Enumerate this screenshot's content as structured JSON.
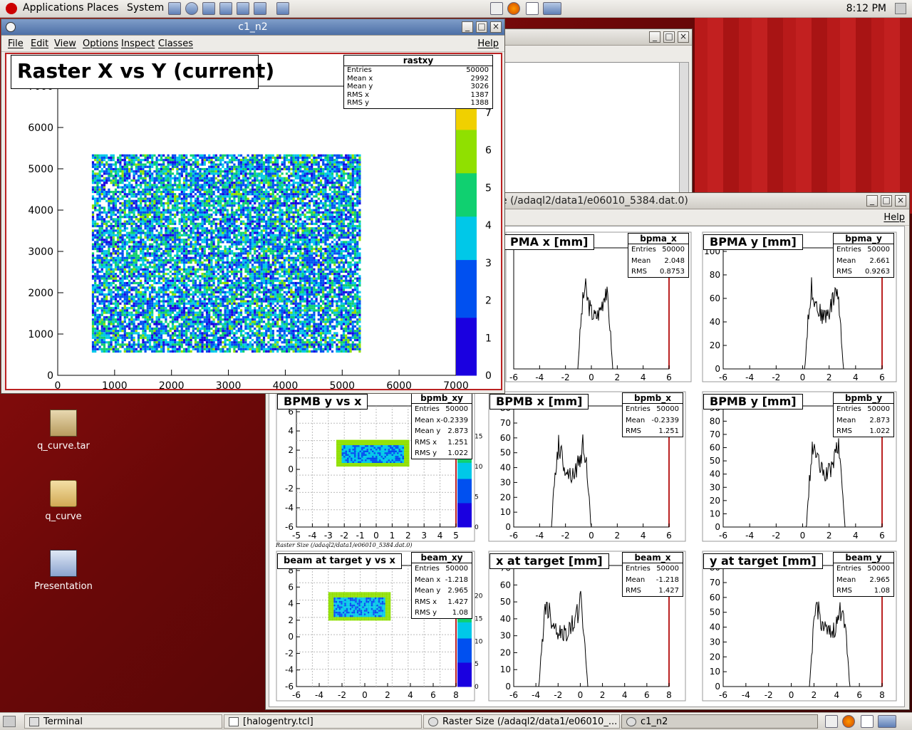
{
  "top_panel": {
    "menus": [
      "Applications",
      "Places",
      "System"
    ],
    "clock": "8:12 PM"
  },
  "bottom_panel": {
    "tasks": [
      "Terminal",
      "[halogentry.tcl]",
      "Raster Size (/adaql2/data1/e06010_...",
      "c1_n2"
    ]
  },
  "desktop_icons": [
    "q_curve.tar",
    "q_curve",
    "Presentation"
  ],
  "canvas_menu": [
    "File",
    "Edit",
    "View",
    "Options",
    "Inspect",
    "Classes"
  ],
  "help": "Help",
  "c1": {
    "window_title": "c1_n2",
    "pad_title": "Raster X vs Y (current)",
    "stats": {
      "name": "rastxy",
      "rows": [
        [
          "Entries",
          "50000"
        ],
        [
          "Mean x",
          "2992"
        ],
        [
          "Mean y",
          "3026"
        ],
        [
          "RMS x",
          "1387"
        ],
        [
          "RMS y",
          "1388"
        ]
      ]
    },
    "x_ticks": [
      "0",
      "1000",
      "2000",
      "3000",
      "4000",
      "5000",
      "6000",
      "7000"
    ],
    "y_ticks": [
      "0",
      "1000",
      "2000",
      "3000",
      "4000",
      "5000",
      "6000",
      "7000"
    ],
    "z_ticks": [
      "0",
      "1",
      "2",
      "3",
      "4",
      "5",
      "6",
      "7"
    ]
  },
  "raster": {
    "window_title_tail": "e (/adaql2/data1/e06010_5384.dat.0)",
    "small_label": "Raster Size (/adaql2/data1/e06010_5384.dat.0)",
    "pads": [
      {
        "title": "PMA x [mm]",
        "stats": {
          "name": "bpma_x",
          "rows": [
            [
              "Entries",
              "50000"
            ],
            [
              "Mean",
              "2.048"
            ],
            [
              "RMS",
              "0.8753"
            ]
          ]
        },
        "x_ticks": [
          "-6",
          "-4",
          "-2",
          "0",
          "2",
          "4",
          "6"
        ],
        "y_ticks": []
      },
      {
        "title": "BPMA y [mm]",
        "stats": {
          "name": "bpma_y",
          "rows": [
            [
              "Entries",
              "50000"
            ],
            [
              "Mean",
              "2.661"
            ],
            [
              "RMS",
              "0.9263"
            ]
          ]
        },
        "x_ticks": [
          "-6",
          "-4",
          "-2",
          "0",
          "2",
          "4",
          "6"
        ],
        "y_ticks": [
          "0",
          "20",
          "40",
          "60",
          "80",
          "100"
        ]
      },
      {
        "title": "BPMB y vs x",
        "stats": {
          "name": "bpmb_xy",
          "rows": [
            [
              "Entries",
              "50000"
            ],
            [
              "Mean x",
              "-0.2339"
            ],
            [
              "Mean y",
              "2.873"
            ],
            [
              "RMS x",
              "1.251"
            ],
            [
              "RMS y",
              "1.022"
            ]
          ]
        },
        "x_ticks": [
          "-5",
          "-4",
          "-3",
          "-2",
          "-1",
          "0",
          "1",
          "2",
          "3",
          "4",
          "5"
        ],
        "y_ticks": [
          "-6",
          "-4",
          "-2",
          "0",
          "2",
          "4",
          "6"
        ],
        "z_ticks": [
          "0",
          "5",
          "10",
          "15"
        ]
      },
      {
        "title": "BPMB x [mm]",
        "stats": {
          "name": "bpmb_x",
          "rows": [
            [
              "Entries",
              "50000"
            ],
            [
              "Mean",
              "-0.2339"
            ],
            [
              "RMS",
              "1.251"
            ]
          ]
        },
        "x_ticks": [
          "-6",
          "-4",
          "-2",
          "0",
          "2",
          "4",
          "6"
        ],
        "y_ticks": [
          "0",
          "10",
          "20",
          "30",
          "40",
          "50",
          "60",
          "70",
          "80"
        ]
      },
      {
        "title": "BPMB y [mm]",
        "stats": {
          "name": "bpmb_y",
          "rows": [
            [
              "Entries",
              "50000"
            ],
            [
              "Mean",
              "2.873"
            ],
            [
              "RMS",
              "1.022"
            ]
          ]
        },
        "x_ticks": [
          "-6",
          "-4",
          "-2",
          "0",
          "2",
          "4",
          "6"
        ],
        "y_ticks": [
          "0",
          "10",
          "20",
          "30",
          "40",
          "50",
          "60",
          "70",
          "80",
          "90"
        ]
      },
      {
        "title": "beam at target y vs x",
        "stats": {
          "name": "beam_xy",
          "rows": [
            [
              "Entries",
              "50000"
            ],
            [
              "Mean x",
              "-1.218"
            ],
            [
              "Mean y",
              "2.965"
            ],
            [
              "RMS x",
              "1.427"
            ],
            [
              "RMS y",
              "1.08"
            ]
          ]
        },
        "x_ticks": [
          "-6",
          "-4",
          "-2",
          "0",
          "2",
          "4",
          "6",
          "8"
        ],
        "y_ticks": [
          "-6",
          "-4",
          "-2",
          "0",
          "2",
          "4",
          "6",
          "8"
        ],
        "z_ticks": [
          "0",
          "5",
          "10",
          "15",
          "20"
        ]
      },
      {
        "title": "x at target [mm]",
        "stats": {
          "name": "beam_x",
          "rows": [
            [
              "Entries",
              "50000"
            ],
            [
              "Mean",
              "-1.218"
            ],
            [
              "RMS",
              "1.427"
            ]
          ]
        },
        "x_ticks": [
          "-6",
          "-4",
          "-2",
          "0",
          "2",
          "4",
          "6",
          "8"
        ],
        "y_ticks": [
          "0",
          "10",
          "20",
          "30",
          "40",
          "50",
          "60",
          "70"
        ]
      },
      {
        "title": "y at target [mm]",
        "stats": {
          "name": "beam_y",
          "rows": [
            [
              "Entries",
              "50000"
            ],
            [
              "Mean",
              "2.965"
            ],
            [
              "RMS",
              "1.08"
            ]
          ]
        },
        "x_ticks": [
          "-6",
          "-4",
          "-2",
          "0",
          "2",
          "4",
          "6",
          "8"
        ],
        "y_ticks": [
          "0",
          "10",
          "20",
          "30",
          "40",
          "50",
          "60",
          "70",
          "80"
        ]
      }
    ]
  },
  "colors": {
    "accent": "#4c6fa6",
    "desktop": "#8a0e0e"
  }
}
